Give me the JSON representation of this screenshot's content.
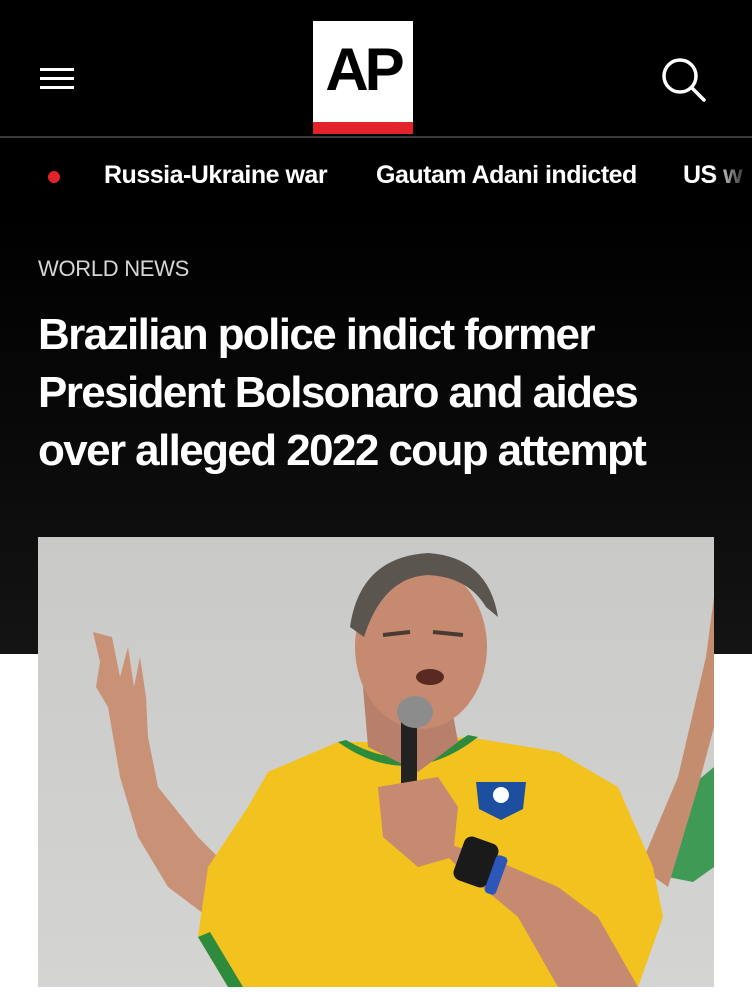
{
  "header": {
    "logo_text": "AP",
    "menu_icon": "hamburger-menu-icon",
    "search_icon": "search-icon"
  },
  "trending": {
    "live_indicator_color": "#e2232a",
    "items": [
      "Russia-Ukraine war",
      "Gautam Adani indicted",
      "US w"
    ]
  },
  "article": {
    "section": "WORLD NEWS",
    "headline": "Brazilian police indict former President Bolsonaro and aides over alleged 2022 coup attempt"
  },
  "colors": {
    "background": "#000000",
    "accent": "#e2232a",
    "text": "#ffffff"
  }
}
